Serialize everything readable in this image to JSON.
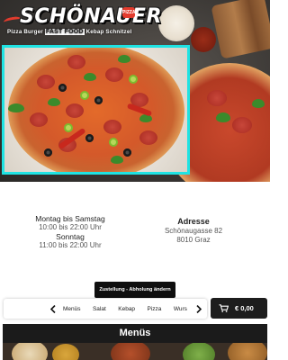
{
  "brand": {
    "name": "SCHÖNAUER",
    "badge": "PIZZA",
    "tagline_pre": "Pizza Burger ",
    "tagline_hl": "FAST FOOD",
    "tagline_post": " Kebap Schnitzel"
  },
  "hours": {
    "weekday_label": "Montag bis Samstag",
    "weekday_time": "10:00 bis 22:00 Uhr",
    "sunday_label": "Sonntag",
    "sunday_time": "11:00 bis 22:00 Uhr"
  },
  "address": {
    "title": "Adresse",
    "street": "Schönaugasse 82",
    "city": "8010 Graz"
  },
  "delivery_toggle": "Zustellung - Abholung ändern",
  "categories": [
    "Menüs",
    "Salat",
    "Kebap",
    "Pizza",
    "Wurs"
  ],
  "cart": {
    "amount": "€ 0,00",
    "icon": "cart-icon"
  },
  "section_title": "Menüs",
  "colors": {
    "accent_cyan": "#1fe3e3",
    "dark": "#1d1d1d",
    "brand_red": "#e23b2d"
  }
}
